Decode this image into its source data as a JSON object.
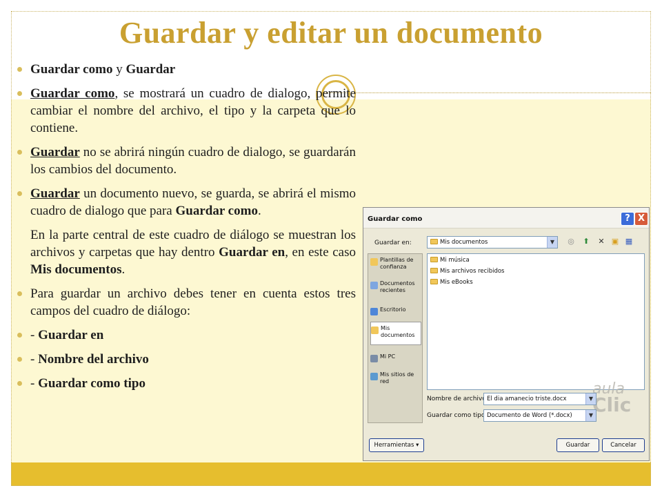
{
  "slide": {
    "title": "Guardar y editar un documento",
    "colors": {
      "title": "#c9a031",
      "body_bg": "#fdf8d2",
      "band": "#e6be2e",
      "bullet": "#d9be5c"
    }
  },
  "bullets": {
    "b1": {
      "a": "Guardar como",
      "b": " y ",
      "c": "Guardar"
    },
    "b2": {
      "a": "Guardar como",
      "b": ", se mostrará un cuadro de dialogo, permite cambiar el nombre del archivo, el tipo y la carpeta que lo contiene."
    },
    "b3": {
      "a": "Guardar",
      "b": " no se abrirá ningún cuadro de dialogo, se guardarán los cambios del documento."
    },
    "b4": {
      "a": "Guardar",
      "b": " un documento nuevo, se guarda, se abrirá el mismo cuadro de dialogo que para ",
      "c": "Guardar como",
      "d": "."
    },
    "p5": {
      "a": " En la parte central de este cuadro de diálogo se muestran los archivos y carpetas que hay dentro ",
      "b": "Guardar en",
      "c": ", en este caso ",
      "d": "Mis documentos",
      "e": "."
    },
    "b6": {
      "a": "Para guardar un archivo debes tener en cuenta estos tres campos del cuadro de diálogo:"
    },
    "b7": {
      "a": "- ",
      "b": "Guardar en"
    },
    "b8": {
      "a": "- ",
      "b": "Nombre del archivo"
    },
    "b9": {
      "a": "- ",
      "b": "Guardar como tipo"
    }
  },
  "dialog": {
    "title": "Guardar como",
    "help_icon": "?",
    "close_icon": "X",
    "save_in_label": "Guardar en:",
    "save_in_value": "Mis documentos",
    "toolbar_icons": [
      "back-icon",
      "up-folder-icon",
      "delete-icon",
      "new-folder-icon",
      "views-icon"
    ],
    "places": [
      {
        "label": "Plantillas de confianza",
        "icon": "folder-icon"
      },
      {
        "label": "Documentos recientes",
        "icon": "recent-docs-icon"
      },
      {
        "label": "Escritorio",
        "icon": "desktop-icon"
      },
      {
        "label": "Mis documentos",
        "icon": "my-documents-icon",
        "selected": true
      },
      {
        "label": "Mi PC",
        "icon": "my-pc-icon"
      },
      {
        "label": "Mis sitios de red",
        "icon": "network-icon"
      }
    ],
    "files": [
      "Mi música",
      "Mis archivos recibidos",
      "Mis eBooks"
    ],
    "filename_label": "Nombre de archivo:",
    "filename_value": "El dia amanecio triste.docx",
    "filetype_label": "Guardar como tipo:",
    "filetype_value": "Documento de Word (*.docx)",
    "tools_button": "Herramientas",
    "save_button": "Guardar",
    "cancel_button": "Cancelar",
    "watermark_1": "aula",
    "watermark_2": "Clic"
  }
}
